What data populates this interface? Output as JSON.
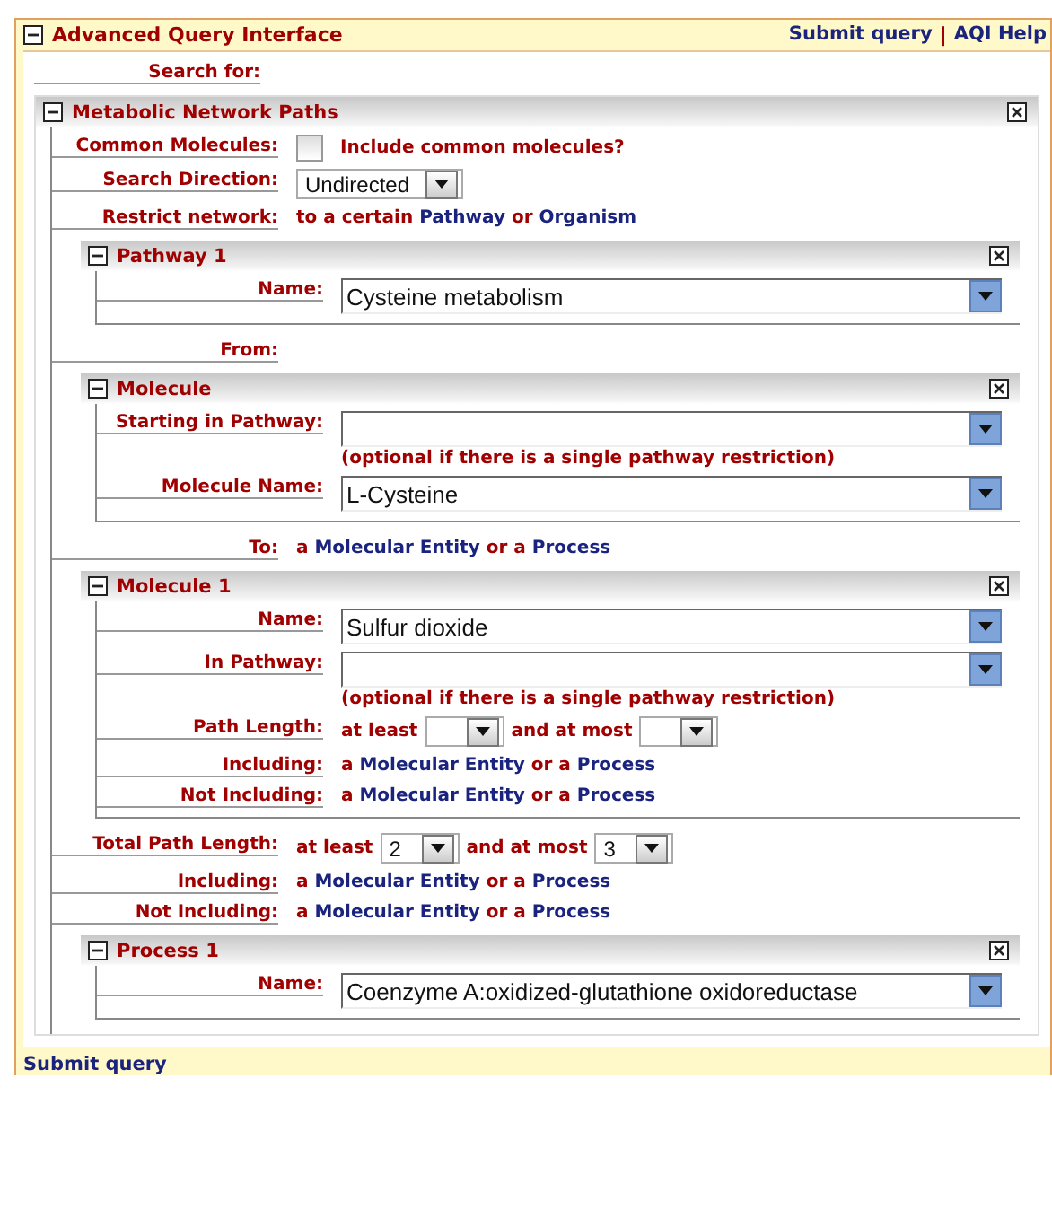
{
  "header": {
    "title": "Advanced Query Interface",
    "expanded": true,
    "links": [
      {
        "kind": "link",
        "text": "Submit query"
      },
      {
        "kind": "separator",
        "text": "|"
      },
      {
        "kind": "link",
        "text": "AQI Help"
      }
    ]
  },
  "search_label": "Search for:",
  "panel": {
    "title": "Metabolic Network Paths",
    "expanded": true,
    "rows": [
      {
        "kind": "checkbox",
        "label": "Common Molecules:",
        "checked": false,
        "text": "Include common molecules?"
      },
      {
        "kind": "dropdown",
        "label": "Search Direction:",
        "value": "Undirected"
      },
      {
        "kind": "links",
        "label": "Restrict network:",
        "parts": [
          {
            "text": "to a certain",
            "link": false
          },
          {
            "text": "Pathway",
            "link": true
          },
          {
            "text": "or",
            "link": false
          },
          {
            "text": "Organism",
            "link": true
          }
        ]
      },
      {
        "kind": "panel",
        "title": "Pathway 1",
        "expanded": true,
        "rows": [
          {
            "kind": "combo",
            "label": "Name:",
            "value": "Cysteine metabolism"
          }
        ]
      },
      {
        "kind": "heading",
        "label": "From:"
      },
      {
        "kind": "panel",
        "title": "Molecule",
        "expanded": true,
        "rows": [
          {
            "kind": "combo",
            "label": "Starting in Pathway:",
            "note": "(optional if there is a single pathway restriction)"
          },
          {
            "kind": "combo",
            "label": "Molecule Name:",
            "value": "L-Cysteine"
          }
        ]
      },
      {
        "kind": "links",
        "label": "To:",
        "parts": [
          {
            "text": "a",
            "link": false
          },
          {
            "text": "Molecular Entity",
            "link": true
          },
          {
            "text": "or a",
            "link": false
          },
          {
            "text": "Process",
            "link": true
          }
        ]
      },
      {
        "kind": "panel",
        "title": "Molecule 1",
        "expanded": true,
        "rows": [
          {
            "kind": "combo",
            "label": "Name:",
            "value": "Sulfur dioxide"
          },
          {
            "kind": "combo",
            "label": "In Pathway:",
            "note": "(optional if there is a single pathway restriction)"
          },
          {
            "kind": "range",
            "label": "Path Length:",
            "parts": [
              {
                "kind": "text",
                "text": "at least"
              },
              {
                "kind": "dropdown"
              },
              {
                "kind": "text",
                "text": "and at most"
              },
              {
                "kind": "dropdown"
              }
            ]
          },
          {
            "kind": "links",
            "label": "Including:",
            "parts": [
              {
                "text": "a",
                "link": false
              },
              {
                "text": "Molecular Entity",
                "link": true
              },
              {
                "text": "or a",
                "link": false
              },
              {
                "text": "Process",
                "link": true
              }
            ]
          },
          {
            "kind": "links",
            "label": "Not Including:",
            "parts": [
              {
                "text": "a",
                "link": false
              },
              {
                "text": "Molecular Entity",
                "link": true
              },
              {
                "text": "or a",
                "link": false
              },
              {
                "text": "Process",
                "link": true
              }
            ]
          }
        ]
      },
      {
        "kind": "range",
        "label": "Total Path Length:",
        "parts": [
          {
            "kind": "text",
            "text": "at least"
          },
          {
            "kind": "dropdown",
            "value": "2"
          },
          {
            "kind": "text",
            "text": "and at most"
          },
          {
            "kind": "dropdown",
            "value": "3"
          }
        ]
      },
      {
        "kind": "links",
        "label": "Including:",
        "parts": [
          {
            "text": "a",
            "link": false
          },
          {
            "text": "Molecular Entity",
            "link": true
          },
          {
            "text": "or a",
            "link": false
          },
          {
            "text": "Process",
            "link": true
          }
        ]
      },
      {
        "kind": "links",
        "label": "Not Including:",
        "parts": [
          {
            "text": "a",
            "link": false
          },
          {
            "text": "Molecular Entity",
            "link": true
          },
          {
            "text": "or a",
            "link": false
          },
          {
            "text": "Process",
            "link": true
          }
        ]
      },
      {
        "kind": "panel",
        "title": "Process 1",
        "expanded": true,
        "rows": [
          {
            "kind": "combo",
            "label": "Name:",
            "value": "Coenzyme A:oxidized-glutathione oxidoreductase"
          }
        ]
      }
    ]
  },
  "footer": {
    "link": "Submit query"
  }
}
